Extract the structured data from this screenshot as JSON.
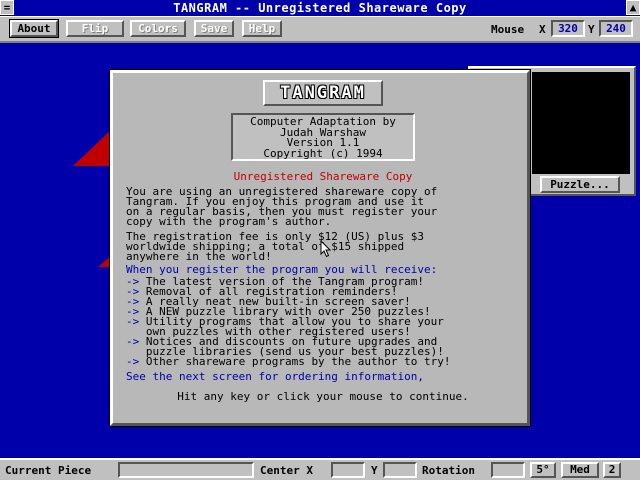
{
  "window": {
    "title": "TANGRAM -- Unregistered Shareware Copy",
    "system_menu_glyph": "=",
    "close_glyph": "▲"
  },
  "toolbar": {
    "about_label": "About",
    "flip_label": "Flip",
    "colors_label": "Colors",
    "save_label": "Save",
    "help_label": "Help",
    "mouse_label": "Mouse",
    "x_label": "X",
    "y_label": "Y",
    "mouse_x": "320",
    "mouse_y": "240"
  },
  "right_panel": {
    "puzzle_button": "Puzzle..."
  },
  "dialog": {
    "title": "TANGRAM",
    "credits": [
      "Computer Adaptation by",
      "Judah Warshaw",
      "Version 1.1",
      "Copyright (c) 1994"
    ],
    "heading": "Unregistered Shareware Copy",
    "intro_lines": [
      "You are using an unregistered shareware copy of",
      "Tangram. If you enjoy this program and use it",
      "on a regular basis, then you must register your",
      "copy with the program's author."
    ],
    "fee_lines": [
      "The registration fee is only $12 (US) plus $3",
      "worldwide shipping; a total of $15 shipped",
      "anywhere in the world!"
    ],
    "benefits_heading": "When you register the program you will receive:",
    "benefits": [
      {
        "arrow": "->",
        "lines": [
          "The latest version of the Tangram program!"
        ]
      },
      {
        "arrow": "->",
        "lines": [
          "Removal of all registration reminders!"
        ]
      },
      {
        "arrow": "->",
        "lines": [
          "A really neat new built-in screen saver!"
        ]
      },
      {
        "arrow": "->",
        "lines": [
          "A NEW puzzle library with over 250 puzzles!"
        ]
      },
      {
        "arrow": "->",
        "lines": [
          "Utility programs that allow you to share your",
          "own puzzles with other registered users!"
        ]
      },
      {
        "arrow": "->",
        "lines": [
          "Notices and discounts on future upgrades and",
          "puzzle libraries (send us your best puzzles)!"
        ]
      },
      {
        "arrow": "->",
        "lines": [
          "Other shareware programs by the author to try!"
        ]
      }
    ],
    "next_screen": "See the next screen for ordering information,",
    "continue_prompt": "Hit any key or click your mouse to continue."
  },
  "status": {
    "current_piece_label": "Current Piece",
    "center_label": "Center X",
    "y_label": "Y",
    "rotation_label": "Rotation",
    "rotation_step": "5°",
    "speed": "Med",
    "level": "2"
  },
  "colors": {
    "desktop": "#0000aa",
    "panel": "#c0c0c0",
    "accent_red": "#c00000",
    "accent_blue": "#0000aa"
  }
}
